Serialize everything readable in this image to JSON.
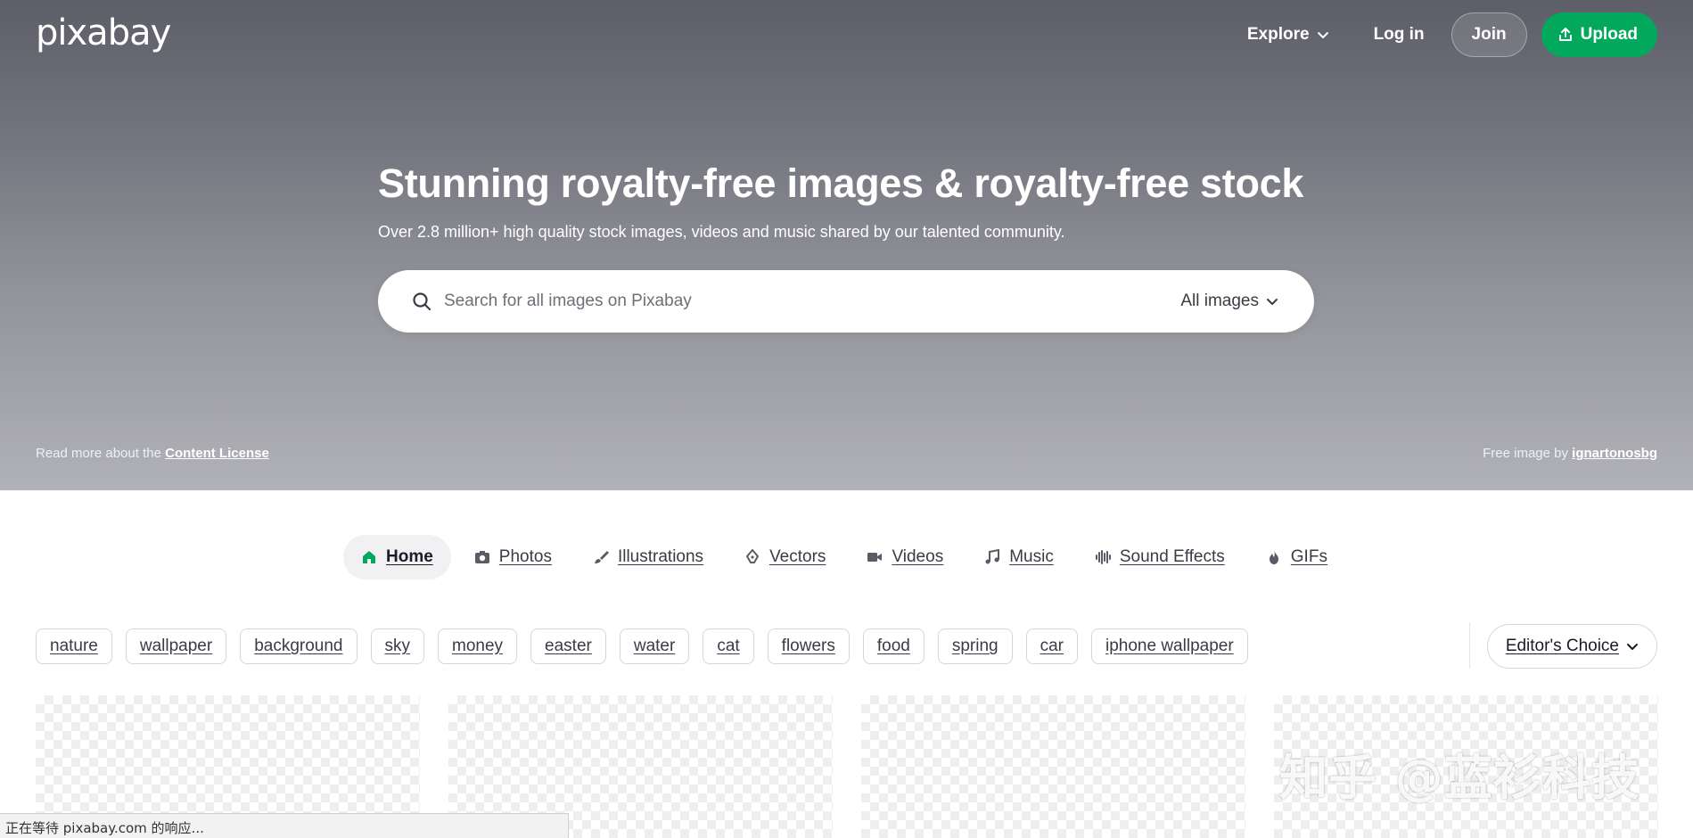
{
  "header": {
    "logo": "pixabay",
    "explore_label": "Explore",
    "login_label": "Log in",
    "join_label": "Join",
    "upload_label": "Upload",
    "upload_color": "#02a95c"
  },
  "hero": {
    "title": "Stunning royalty-free images & royalty-free stock",
    "subtitle": "Over 2.8 million+ high quality stock images, videos and music shared by our talented community."
  },
  "search": {
    "placeholder": "Search for all images on Pixabay",
    "value": "",
    "filter_label": "All images"
  },
  "license": {
    "prefix": "Read more about the",
    "link": "Content License"
  },
  "credit": {
    "prefix": "Free image by",
    "author": "ignartonosbg"
  },
  "categories": [
    {
      "label": "Home",
      "icon": "home-icon",
      "active": true
    },
    {
      "label": "Photos",
      "icon": "camera-icon",
      "active": false
    },
    {
      "label": "Illustrations",
      "icon": "brush-icon",
      "active": false
    },
    {
      "label": "Vectors",
      "icon": "pen-nib-icon",
      "active": false
    },
    {
      "label": "Videos",
      "icon": "video-camera-icon",
      "active": false
    },
    {
      "label": "Music",
      "icon": "music-note-icon",
      "active": false
    },
    {
      "label": "Sound Effects",
      "icon": "waveform-icon",
      "active": false
    },
    {
      "label": "GIFs",
      "icon": "flame-icon",
      "active": false
    }
  ],
  "tags": [
    "nature",
    "wallpaper",
    "background",
    "sky",
    "money",
    "easter",
    "water",
    "cat",
    "flowers",
    "food",
    "spring",
    "car",
    "iphone wallpaper"
  ],
  "sort": {
    "label": "Editor's Choice"
  },
  "watermark": "知乎 @蓝衫科技",
  "status_bar": "正在等待 pixabay.com 的响应..."
}
